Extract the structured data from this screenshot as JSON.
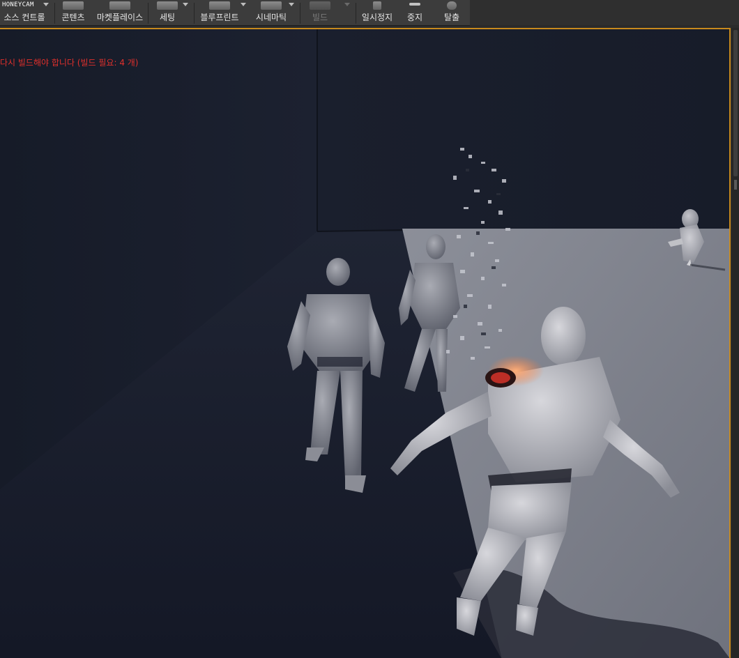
{
  "watermark": "HONEYCAM",
  "toolbar": {
    "items": [
      {
        "label": "소스 컨트롤"
      },
      {
        "label": "콘텐츠"
      },
      {
        "label": "마켓플레이스"
      },
      {
        "label": "세팅"
      },
      {
        "label": "블루프린트"
      },
      {
        "label": "시네마틱"
      },
      {
        "label": "빌드",
        "disabled": true
      },
      {
        "label": "일시정지"
      },
      {
        "label": "중지"
      },
      {
        "label": "탈출"
      }
    ]
  },
  "viewport": {
    "warning": "다시 빌드해야 합니다 (빌드 필요: 4 개)",
    "accent_color": "#c88a1d",
    "warning_color": "#e0302c"
  }
}
